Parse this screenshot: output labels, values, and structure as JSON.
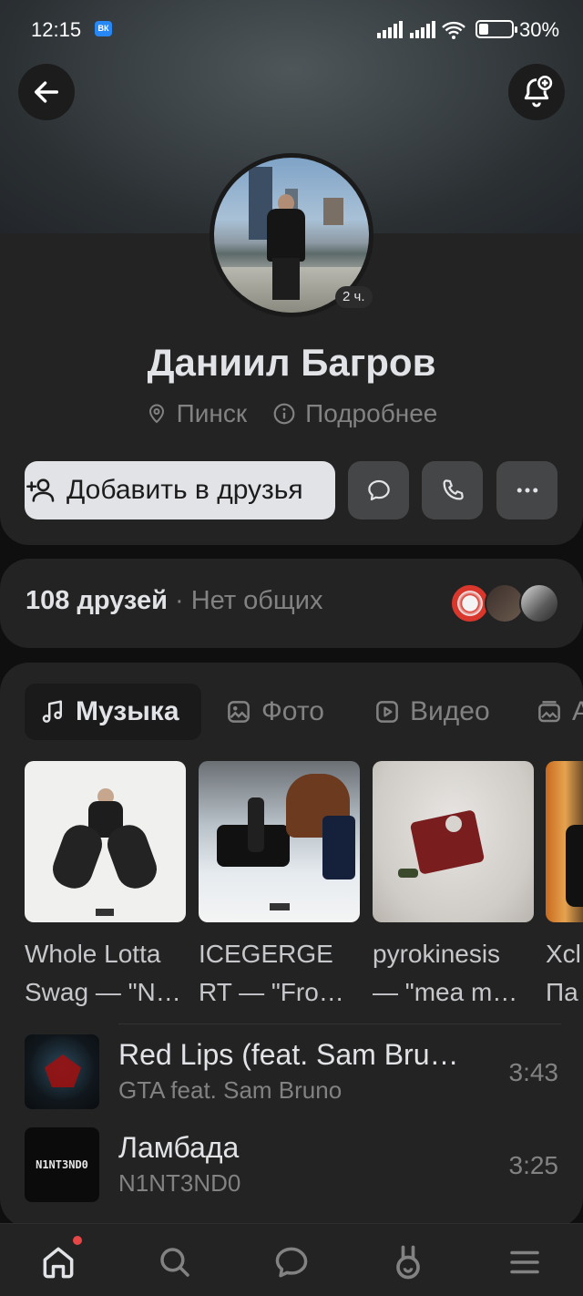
{
  "status_bar": {
    "time": "12:15",
    "app_icon": "ВК",
    "battery_percent": "30%"
  },
  "header": {
    "back_icon": "arrow-left-icon",
    "bell_icon": "bell-plus-icon"
  },
  "profile": {
    "name": "Даниил Багров",
    "avatar_badge": "2 ч.",
    "city": "Пинск",
    "more_info": "Подробнее",
    "add_friend_label": "Добавить в друзья"
  },
  "friends": {
    "count": "108 друзей",
    "separator": "·",
    "common": "Нет общих"
  },
  "tabs": [
    {
      "label": "Музыка",
      "icon": "music-note-icon"
    },
    {
      "label": "Фото",
      "icon": "photo-icon"
    },
    {
      "label": "Видео",
      "icon": "video-icon"
    },
    {
      "label": "А",
      "icon": "album-icon"
    }
  ],
  "albums": [
    {
      "title_line1": "Whole Lotta",
      "title_line2": "Swag — \"N…"
    },
    {
      "title_line1": "ICEGERGE",
      "title_line2": "RT — \"Fro…"
    },
    {
      "title_line1": "pyrokinesis",
      "title_line2": "— \"mea m…"
    },
    {
      "title_line1": "Xcl",
      "title_line2": "Па"
    }
  ],
  "tracks": [
    {
      "title": "Red Lips (feat. Sam Bru…",
      "artist": "GTA feat. Sam Bruno",
      "duration": "3:43"
    },
    {
      "title": "Ламбада",
      "artist": "N1NT3ND0",
      "duration": "3:25",
      "cover_text": "N1NT3ND0"
    }
  ],
  "nav": [
    "home-icon",
    "search-icon",
    "messages-icon",
    "clips-icon",
    "menu-icon"
  ]
}
